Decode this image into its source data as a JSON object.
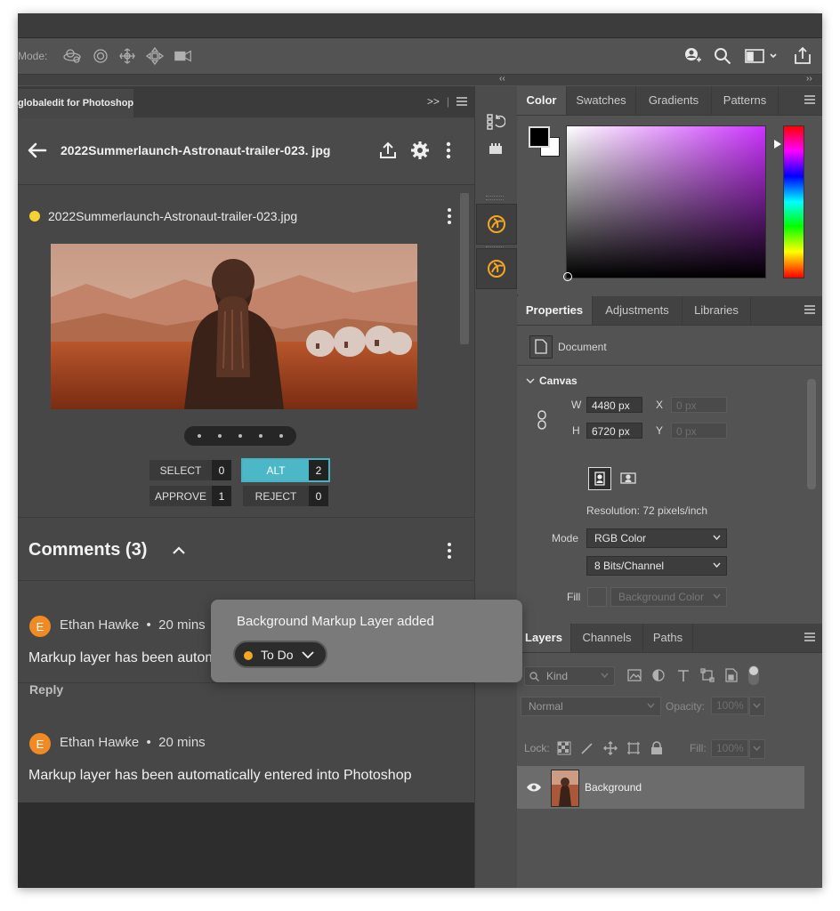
{
  "options_bar": {
    "mode_label": "Mode:",
    "tool_icons": [
      "orbit-3d-icon",
      "roll-3d-icon",
      "pan-3d-icon",
      "slide-3d-icon",
      "camera-3d-icon"
    ],
    "right_icons": [
      "user-search-icon",
      "search-icon",
      "workspace-icon",
      "share-icon"
    ]
  },
  "globaledit": {
    "tab_label": "globaledit for Photoshop",
    "header_title": "2022Summerlaunch-Astronaut-trailer-023. jpg",
    "asset": {
      "status_color": "#f5d232",
      "filename": "2022Summerlaunch-Astronaut-trailer-023.jpg",
      "page_dots": 5
    },
    "votes": [
      {
        "label": "SELECT",
        "count": "0"
      },
      {
        "label": "ALT",
        "count": "2"
      },
      {
        "label": "APPROVE",
        "count": "1"
      },
      {
        "label": "REJECT",
        "count": "0"
      }
    ],
    "comments_title": "Comments (3)",
    "comments": [
      {
        "initial": "E",
        "author": "Ethan Hawke",
        "time": "20 mins",
        "text": "Markup layer has been automatically entered into Photoshop",
        "reply": "Reply"
      },
      {
        "initial": "E",
        "author": "Ethan Hawke",
        "time": "20 mins",
        "text": "Markup layer has been automatically entered into Photoshop"
      }
    ]
  },
  "toast": {
    "message": "Background Markup Layer added",
    "status": "To Do",
    "status_color": "#f5a623"
  },
  "color_panel": {
    "tabs": [
      "Color",
      "Swatches",
      "Gradients",
      "Patterns"
    ],
    "active_tab": "Color",
    "picker_hue": "#cc33ff"
  },
  "properties_panel": {
    "tabs": [
      "Properties",
      "Adjustments",
      "Libraries"
    ],
    "active_tab": "Properties",
    "doc_label": "Document",
    "section": "Canvas",
    "w_label": "W",
    "w_value": "4480 px",
    "h_label": "H",
    "h_value": "6720 px",
    "x_label": "X",
    "x_placeholder": "0 px",
    "y_label": "Y",
    "y_placeholder": "0 px",
    "resolution": "Resolution: 72 pixels/inch",
    "mode_label": "Mode",
    "mode_value": "RGB Color",
    "bits_value": "8 Bits/Channel",
    "fill_label": "Fill",
    "fill_value": "Background Color"
  },
  "layers_panel": {
    "tabs": [
      "Layers",
      "Channels",
      "Paths"
    ],
    "active_tab": "Layers",
    "kind_label": "Kind",
    "blend_mode": "Normal",
    "opacity_label": "Opacity:",
    "opacity_value": "100%",
    "lock_label": "Lock:",
    "fill_label": "Fill:",
    "fill_value": "100%",
    "layers": [
      {
        "name": "Background",
        "visible": true
      }
    ]
  }
}
